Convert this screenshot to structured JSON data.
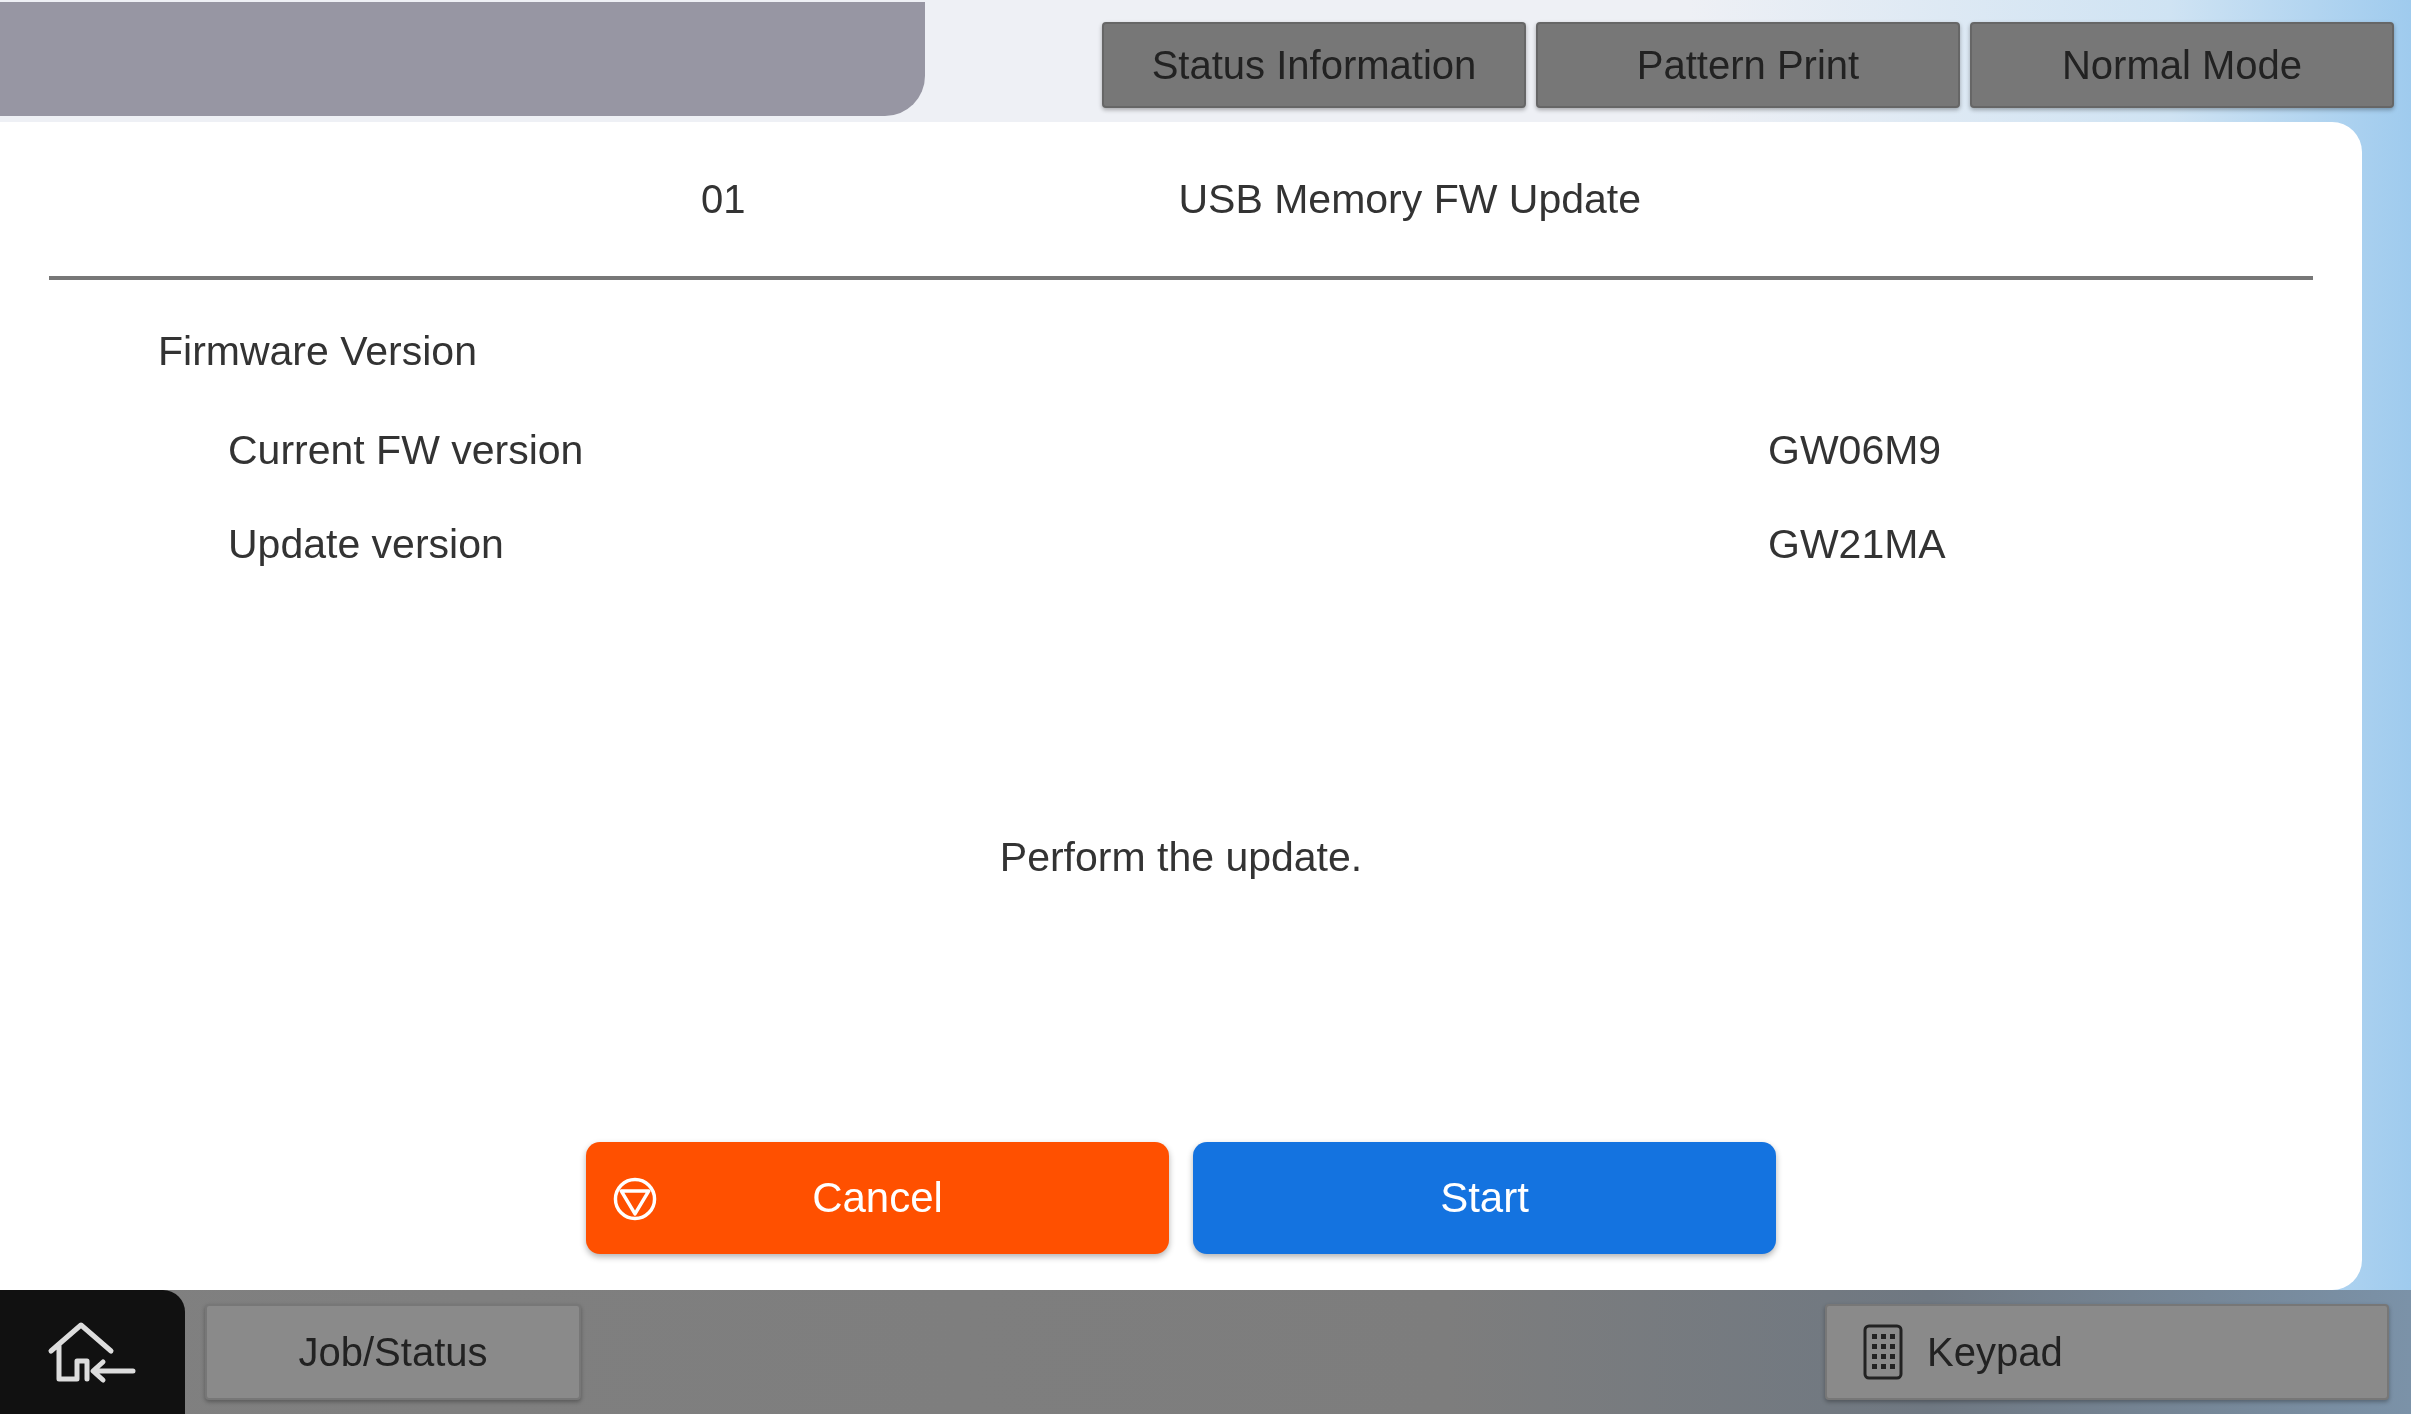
{
  "top_tabs": [
    {
      "label": "Status Information"
    },
    {
      "label": "Pattern Print"
    },
    {
      "label": "Normal Mode"
    }
  ],
  "header": {
    "number": "01",
    "title": "USB Memory FW Update"
  },
  "section": {
    "title": "Firmware Version",
    "rows": [
      {
        "label": "Current FW version",
        "value": "GW06M9"
      },
      {
        "label": "Update version",
        "value": "GW21MA"
      }
    ]
  },
  "message": "Perform the update.",
  "buttons": [
    {
      "kind": "cancel",
      "label": "Cancel"
    },
    {
      "kind": "start",
      "label": "Start"
    }
  ],
  "bottom_bar": {
    "job_status": "Job/Status",
    "keypad": "Keypad"
  }
}
